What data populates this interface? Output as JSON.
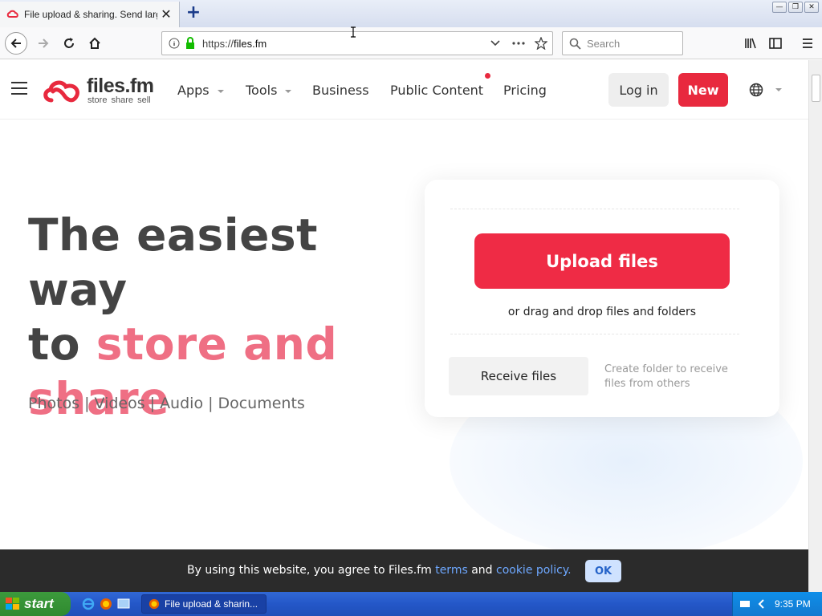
{
  "browser": {
    "tab_title": "File upload & sharing. Send large files",
    "url_scheme": "https://",
    "url_host": "files.fm",
    "search_placeholder": "Search"
  },
  "site": {
    "logo_name": "files.fm",
    "logo_tagline": "store  share  sell",
    "nav": {
      "apps": "Apps",
      "tools": "Tools",
      "business": "Business",
      "public_content": "Public Content",
      "pricing": "Pricing"
    },
    "login_label": "Log in",
    "new_label": "New"
  },
  "hero": {
    "title_line1": "The easiest way",
    "title_line2_prefix": "to ",
    "title_line2_accent": "store and",
    "title_line3_accent": "share",
    "subtitle": [
      "Photos",
      "Videos",
      "Audio",
      "Documents"
    ],
    "separator": "|"
  },
  "upload_card": {
    "upload_label": "Upload files",
    "drag_text": "or drag and drop files and folders",
    "receive_label": "Receive files",
    "receive_desc": "Create folder to receive files from others"
  },
  "cookie": {
    "text_before": "By using this website, you agree to Files.fm ",
    "terms_link": "terms",
    "text_middle": " and ",
    "cookie_link": "cookie policy.",
    "ok_label": "OK"
  },
  "taskbar": {
    "start_label": "start",
    "task_label": "File upload & sharin...",
    "clock": "9:35 PM"
  },
  "colors": {
    "brand_red": "#ef2b45",
    "accent_pink": "#ef6f84",
    "link_blue": "#6ea8ff"
  }
}
